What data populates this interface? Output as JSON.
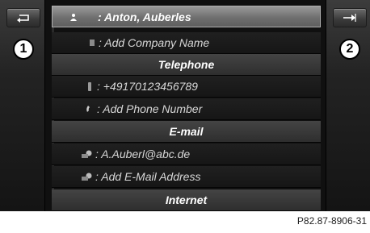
{
  "contact": {
    "name_row": ": Anton, Auberles",
    "company_row": ": Add Company Name"
  },
  "sections": {
    "telephone_header": "Telephone",
    "phone_row": ": +49170123456789",
    "add_phone_row": ": Add Phone Number",
    "email_header": "E-mail",
    "email_row": ": A.Auberl@abc.de",
    "add_email_row": ": Add E-Mail Address",
    "internet_header": "Internet"
  },
  "callouts": {
    "left": "1",
    "right": "2"
  },
  "icons": {
    "back": "back-arrow-icon",
    "right_button": "arrow-right-icon",
    "person": "person-icon",
    "company": "company-icon",
    "phone": "mobile-phone-icon",
    "add_phone": "handset-icon",
    "email": "email-icon"
  },
  "caption": "P82.87-8906-31",
  "colors": {
    "screen_bg": "#0b0b0b",
    "selected": "#8a8a8a",
    "header": "#3a3a3a",
    "text": "#d8d8d8"
  }
}
